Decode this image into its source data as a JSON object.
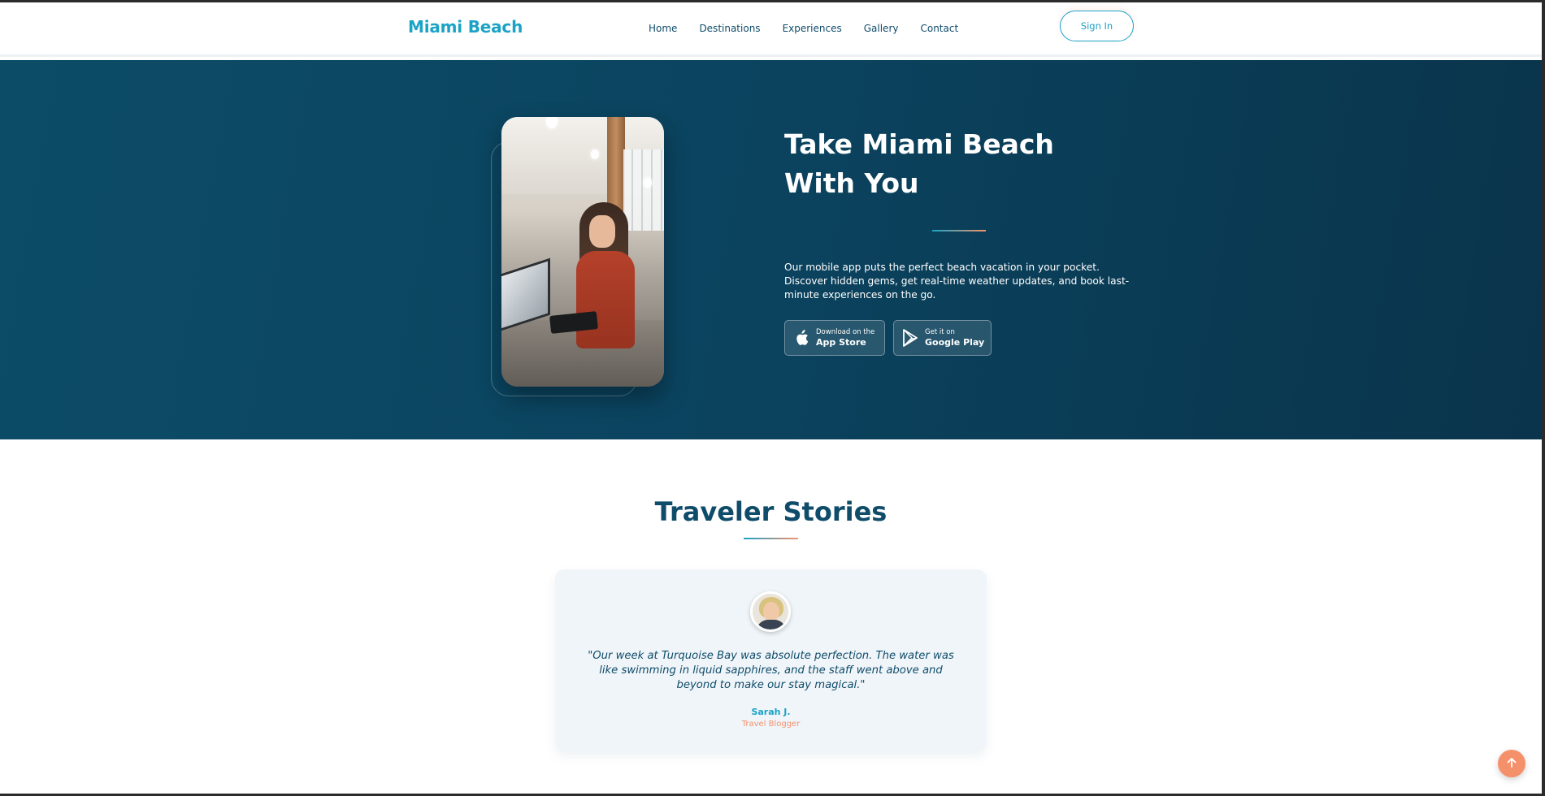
{
  "header": {
    "logo": "Miami Beach",
    "nav": [
      "Home",
      "Destinations",
      "Experiences",
      "Gallery",
      "Contact"
    ],
    "sign_in": "Sign In"
  },
  "hero": {
    "title": "Take Miami Beach With You",
    "description": "Our mobile app puts the perfect beach vacation in your pocket. Discover hidden gems, get real-time weather updates, and book last-minute experiences on the go.",
    "app_store": {
      "small": "Download on the",
      "big": "App Store",
      "icon": "apple-icon"
    },
    "google_play": {
      "small": "Get it on",
      "big": "Google Play",
      "icon": "play-store-icon"
    }
  },
  "stories": {
    "title": "Traveler Stories",
    "testimonial": {
      "quote": "\"Our week at Turquoise Bay was absolute perfection. The water was like swimming in liquid sapphires, and the staff went above and beyond to make our stay magical.\"",
      "name": "Sarah J.",
      "role": "Travel Blogger"
    }
  },
  "colors": {
    "primary": "#1ba3c6",
    "dark": "#0f4c6a",
    "accent": "#f5916a"
  },
  "scroll_top_icon": "arrow-up-icon"
}
